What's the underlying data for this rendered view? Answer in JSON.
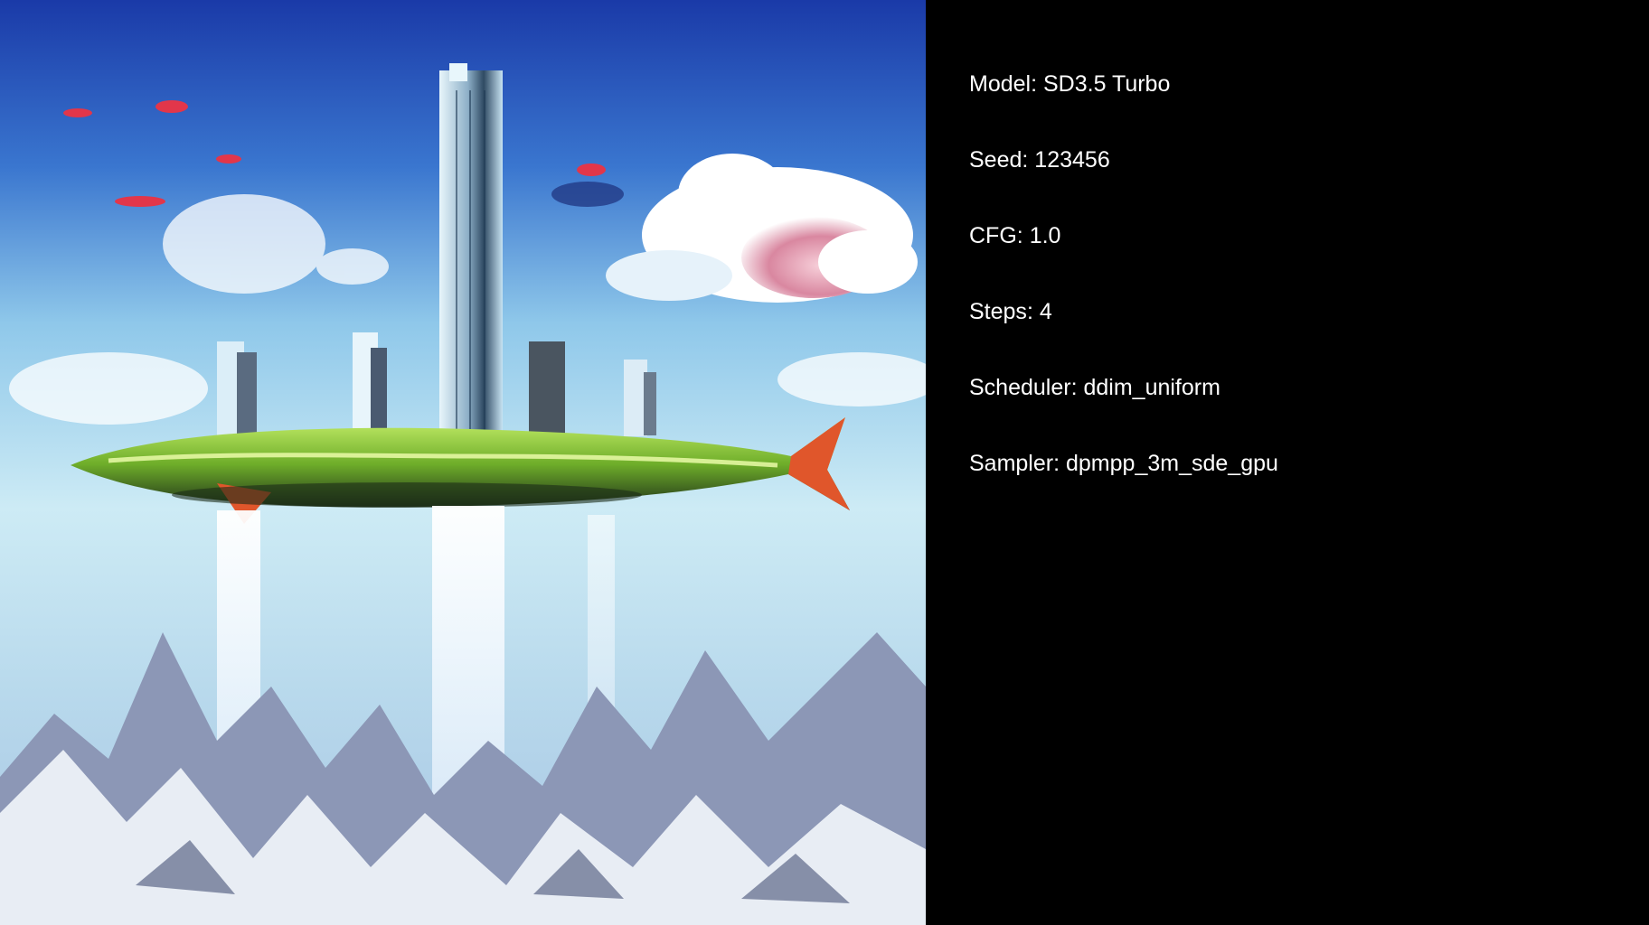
{
  "generated_image": {
    "icon": "generated-image",
    "palette": {
      "sky_top": "#1a3aa8",
      "sky_mid": "#4f9ad8",
      "sky_low": "#bfe4f2",
      "cloud": "#ffffff",
      "cloud_pink": "#e9a0b0",
      "tower": "#c9e6f0",
      "island_green": "#9bd43a",
      "island_dark": "#1b2b18",
      "fin_orange": "#e0562b",
      "mountain": "#8c97b6",
      "mountain_snow": "#f2f6fb"
    }
  },
  "metadata": [
    {
      "label": "Model",
      "value": "SD3.5 Turbo"
    },
    {
      "label": "Seed",
      "value": "123456"
    },
    {
      "label": "CFG",
      "value": "1.0"
    },
    {
      "label": "Steps",
      "value": "4"
    },
    {
      "label": "Scheduler",
      "value": "ddim_uniform"
    },
    {
      "label": "Sampler",
      "value": "dpmpp_3m_sde_gpu"
    }
  ],
  "separator": ": "
}
